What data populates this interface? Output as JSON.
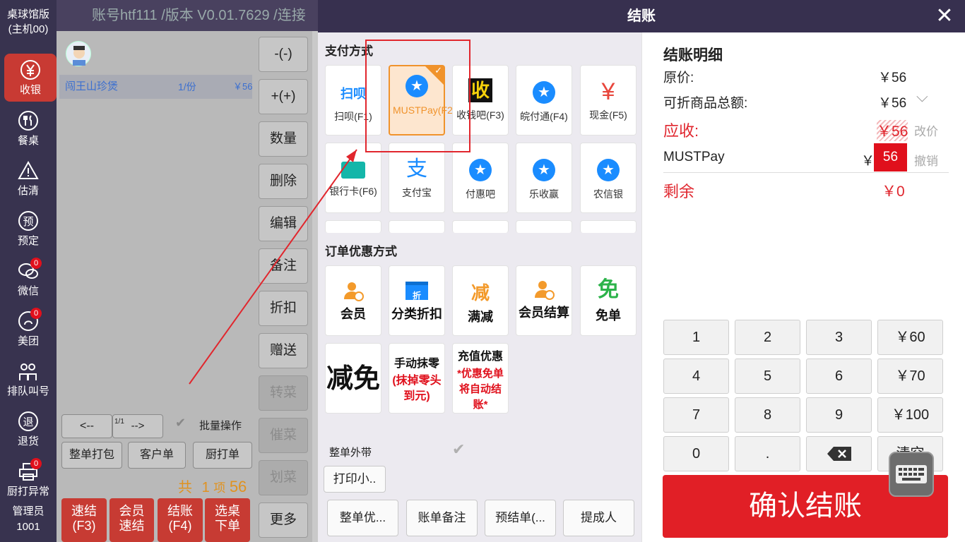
{
  "nav": {
    "logo_line1": "桌球馆版",
    "logo_line2": "(主机00)",
    "items": [
      {
        "label": "收银",
        "icon": "yen-icon"
      },
      {
        "label": "餐桌",
        "icon": "fork-knife-icon"
      },
      {
        "label": "估清",
        "icon": "warning-icon"
      },
      {
        "label": "预定",
        "icon": "reserve-icon"
      },
      {
        "label": "微信",
        "icon": "wechat-icon",
        "badge": "0"
      },
      {
        "label": "美团",
        "icon": "meituan-icon",
        "badge": "0"
      },
      {
        "label": "排队叫号",
        "icon": "queue-icon"
      },
      {
        "label": "退货",
        "icon": "return-icon"
      },
      {
        "label": "厨打异常",
        "icon": "printer-icon",
        "badge": "0"
      }
    ],
    "admin_line1": "管理员",
    "admin_line2": "1001"
  },
  "topbar": {
    "title": "账号htf111 /版本 V0.01.7629 /连接"
  },
  "order": {
    "item_name": "闯王山珍煲",
    "item_qty": "1/份",
    "item_price": "￥56",
    "page_prev": "<--",
    "page_info": "1/1",
    "page_next": "-->",
    "batch_label": "批量操作",
    "pack_btn": "整单打包",
    "customer_btn": "客户单",
    "kitchen_btn": "厨打单",
    "total_prefix": "共",
    "total_count": "1",
    "total_unit": "项",
    "total_amount": "56",
    "quick_btn1": "速结",
    "quick_btn1_key": "(F3)",
    "member_quick1": "会员",
    "member_quick2": "速结",
    "checkout1": "结账",
    "checkout2": "(F4)",
    "select1": "选桌",
    "select2": "下单"
  },
  "midbuttons": [
    "-(-)",
    "+(+)",
    "数量",
    "删除",
    "编辑",
    "备注",
    "折扣",
    "赠送",
    "转菜",
    "催菜",
    "划菜",
    "更多"
  ],
  "modal": {
    "title": "结账",
    "pay_section": "支付方式",
    "pay_methods": [
      {
        "label": "扫呗(F1)",
        "logo": "扫呗"
      },
      {
        "label": "MUSTPay(F2)"
      },
      {
        "label": "收钱吧(F3)",
        "logo": "收"
      },
      {
        "label": "皖付通(F4)"
      },
      {
        "label": "现金(F5)",
        "logo": "¥"
      },
      {
        "label": "银行卡(F6)"
      },
      {
        "label": "支付宝",
        "logo": "支"
      },
      {
        "label": "付惠吧"
      },
      {
        "label": "乐收赢"
      },
      {
        "label": "农信银"
      }
    ],
    "disc_section": "订单优惠方式",
    "discounts": [
      {
        "label": "会员"
      },
      {
        "label": "分类折扣",
        "logo": "折"
      },
      {
        "label": "满减",
        "logo": "减"
      },
      {
        "label": "会员结算"
      },
      {
        "label": "免单",
        "logo": "免"
      },
      {
        "label": "减免"
      },
      {
        "label": "手动抹零",
        "sub": "(抹掉零头到元)"
      },
      {
        "label": "充值优惠",
        "sub": "*优惠免单将自动结账*"
      }
    ],
    "takeaway_label": "整单外带",
    "print_small": "打印小..",
    "bottom_buttons": [
      "整单优...",
      "账单备注",
      "预结单(...",
      "提成人"
    ],
    "detail": {
      "title": "结账明细",
      "orig_label": "原价:",
      "orig_value": "￥56",
      "discountable_label": "可折商品总额:",
      "discountable_value": "￥56",
      "due_label": "应收:",
      "due_value": "￥56",
      "change_price": "改价",
      "mustpay_label": "MUSTPay",
      "mustpay_currency": "￥",
      "mustpay_value": "56",
      "cancel": "撤销",
      "remain_label": "剩余",
      "remain_value": "￥0"
    },
    "keypad": [
      "1",
      "2",
      "3",
      "￥60",
      "4",
      "5",
      "6",
      "￥70",
      "7",
      "8",
      "9",
      "￥100",
      "0",
      ".",
      "",
      "清空"
    ],
    "confirm": "确认结账"
  },
  "colors": {
    "primary_red": "#e11f26",
    "nav_bg": "#38334f",
    "select_orange": "#f0932c",
    "star_blue": "#1a8cff"
  }
}
